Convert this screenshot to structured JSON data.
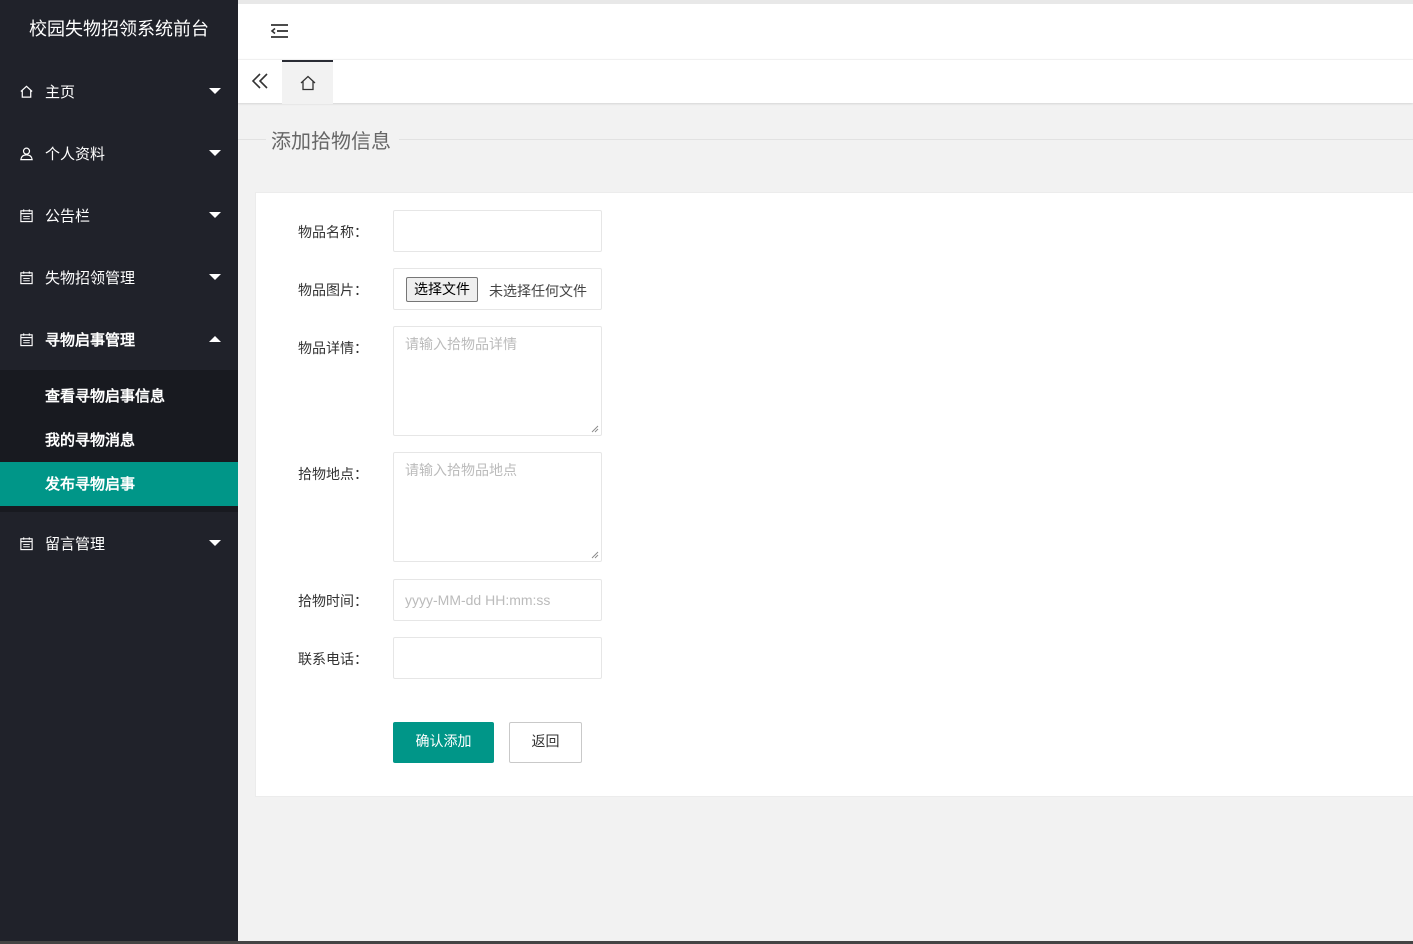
{
  "sidebar": {
    "title": "校园失物招领系统前台",
    "items": [
      {
        "label": "主页",
        "icon": "home-icon"
      },
      {
        "label": "个人资料",
        "icon": "user-icon"
      },
      {
        "label": "公告栏",
        "icon": "calendar-icon"
      },
      {
        "label": "失物招领管理",
        "icon": "calendar-icon"
      },
      {
        "label": "寻物启事管理",
        "icon": "calendar-icon"
      },
      {
        "label": "留言管理",
        "icon": "calendar-icon"
      }
    ],
    "subitems": [
      {
        "label": "查看寻物启事信息"
      },
      {
        "label": "我的寻物消息"
      },
      {
        "label": "发布寻物启事"
      }
    ]
  },
  "page": {
    "title": "添加拾物信息"
  },
  "form": {
    "name_label": "物品名称：",
    "name_value": "",
    "image_label": "物品图片：",
    "file_button": "选择文件",
    "file_status": "未选择任何文件",
    "detail_label": "物品详情：",
    "detail_placeholder": "请输入拾物品详情",
    "location_label": "拾物地点：",
    "location_placeholder": "请输入拾物品地点",
    "time_label": "拾物时间：",
    "time_placeholder": "yyyy-MM-dd HH:mm:ss",
    "phone_label": "联系电话：",
    "phone_value": "",
    "submit_label": "确认添加",
    "back_label": "返回"
  },
  "colors": {
    "sidebar_bg": "#20222a",
    "accent": "#009688"
  }
}
